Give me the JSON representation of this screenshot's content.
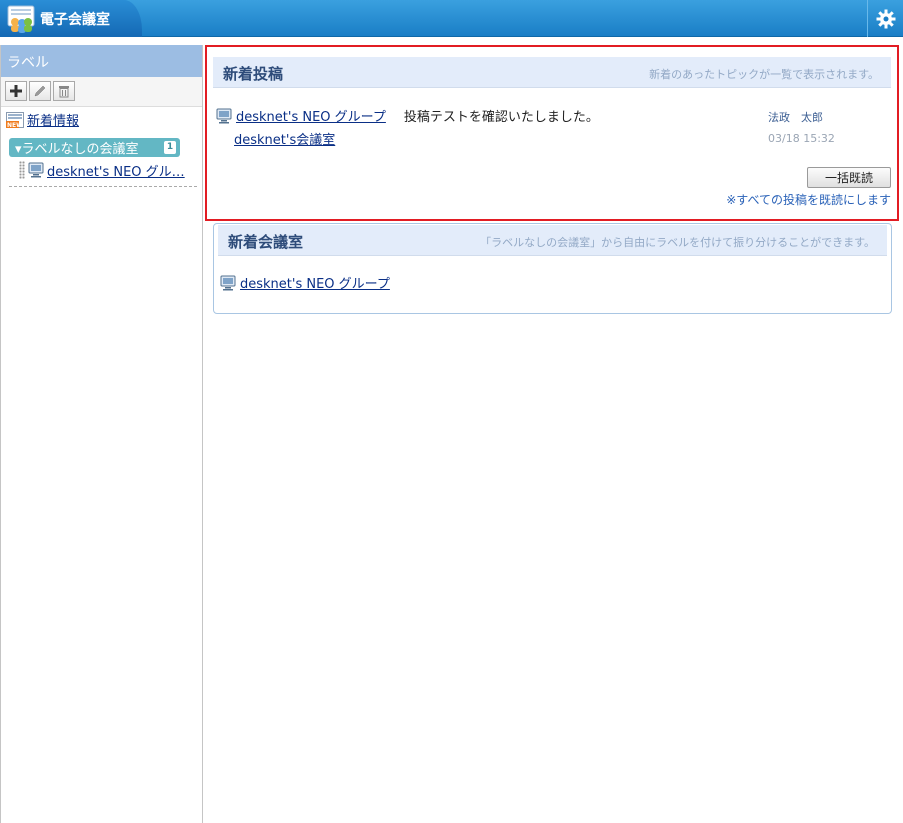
{
  "header": {
    "title": "電子会議室",
    "icons": {
      "app": "meeting-people-icon",
      "settings": "gear-icon"
    }
  },
  "sidebar": {
    "heading": "ラベル",
    "toolbar": {
      "add": "add-icon",
      "edit": "pencil-icon",
      "delete": "trash-icon"
    },
    "news_link": "新着情報",
    "label_group": {
      "name": "▾ラベルなしの会議室",
      "count": "1"
    },
    "tree_items": [
      {
        "label": "desknet's NEO グル…"
      }
    ]
  },
  "new_posts": {
    "title": "新着投稿",
    "description": "新着のあったトピックが一覧で表示されます。",
    "items": [
      {
        "group": "desknet's NEO グループ",
        "room": "desknet's会議室",
        "message": "投稿テストを確認いたしました。",
        "author": "法政　太郎",
        "time": "03/18 15:32"
      }
    ],
    "bulk_read_label": "一括既読",
    "mark_all_read_link": "※すべての投稿を既読にします"
  },
  "new_rooms": {
    "title": "新着会議室",
    "description": "「ラベルなしの会議室」から自由にラベルを付けて振り分けることができます。",
    "items": [
      {
        "label": "desknet's NEO グループ"
      }
    ]
  },
  "colors": {
    "header_blue": "#1a7ec6",
    "highlight_red": "#e21c23",
    "label_teal": "#63b7c4",
    "sidebar_head": "#9cbde3"
  }
}
